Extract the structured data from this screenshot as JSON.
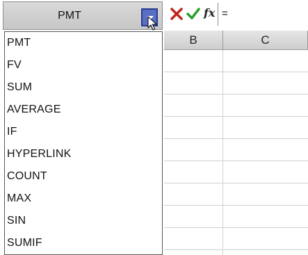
{
  "name_box": {
    "value": "PMT"
  },
  "formula_bar": {
    "cancel_icon": "cross-icon",
    "enter_icon": "checkmark-icon",
    "function_label": "fx",
    "value": "="
  },
  "columns": [
    "B",
    "C"
  ],
  "function_list": {
    "items": [
      "PMT",
      "FV",
      "SUM",
      "AVERAGE",
      "IF",
      "HYPERLINK",
      "COUNT",
      "MAX",
      "SIN",
      "SUMIF"
    ]
  },
  "colors": {
    "cancel": "#c0241a",
    "enter": "#2aa02a",
    "dropdown_button": "#5a6ec4"
  }
}
